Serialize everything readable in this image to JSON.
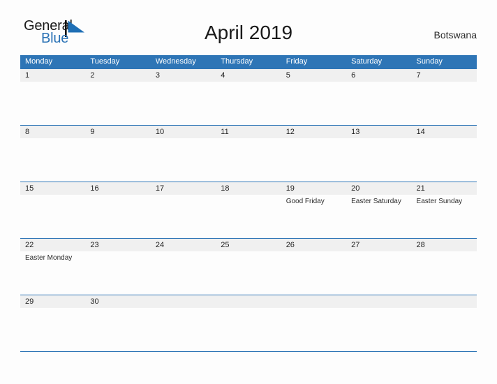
{
  "logo": {
    "word_one": "General",
    "word_two": "Blue",
    "mark_icon": "triangle-sail-icon",
    "brand_color": "#2a72b5"
  },
  "header": {
    "title": "April 2019",
    "country": "Botswana"
  },
  "theme": {
    "header_blue": "#2e75b6",
    "band_gray": "#f0f0f0",
    "page_background": "#fdfdfd",
    "text_dark": "#222222"
  },
  "calendar": {
    "day_names": [
      "Monday",
      "Tuesday",
      "Wednesday",
      "Thursday",
      "Friday",
      "Saturday",
      "Sunday"
    ],
    "weeks": [
      [
        {
          "day": "1",
          "event": ""
        },
        {
          "day": "2",
          "event": ""
        },
        {
          "day": "3",
          "event": ""
        },
        {
          "day": "4",
          "event": ""
        },
        {
          "day": "5",
          "event": ""
        },
        {
          "day": "6",
          "event": ""
        },
        {
          "day": "7",
          "event": ""
        }
      ],
      [
        {
          "day": "8",
          "event": ""
        },
        {
          "day": "9",
          "event": ""
        },
        {
          "day": "10",
          "event": ""
        },
        {
          "day": "11",
          "event": ""
        },
        {
          "day": "12",
          "event": ""
        },
        {
          "day": "13",
          "event": ""
        },
        {
          "day": "14",
          "event": ""
        }
      ],
      [
        {
          "day": "15",
          "event": ""
        },
        {
          "day": "16",
          "event": ""
        },
        {
          "day": "17",
          "event": ""
        },
        {
          "day": "18",
          "event": ""
        },
        {
          "day": "19",
          "event": "Good Friday"
        },
        {
          "day": "20",
          "event": "Easter Saturday"
        },
        {
          "day": "21",
          "event": "Easter Sunday"
        }
      ],
      [
        {
          "day": "22",
          "event": "Easter Monday"
        },
        {
          "day": "23",
          "event": ""
        },
        {
          "day": "24",
          "event": ""
        },
        {
          "day": "25",
          "event": ""
        },
        {
          "day": "26",
          "event": ""
        },
        {
          "day": "27",
          "event": ""
        },
        {
          "day": "28",
          "event": ""
        }
      ],
      [
        {
          "day": "29",
          "event": ""
        },
        {
          "day": "30",
          "event": ""
        },
        {
          "day": "",
          "event": ""
        },
        {
          "day": "",
          "event": ""
        },
        {
          "day": "",
          "event": ""
        },
        {
          "day": "",
          "event": ""
        },
        {
          "day": "",
          "event": ""
        }
      ]
    ]
  }
}
